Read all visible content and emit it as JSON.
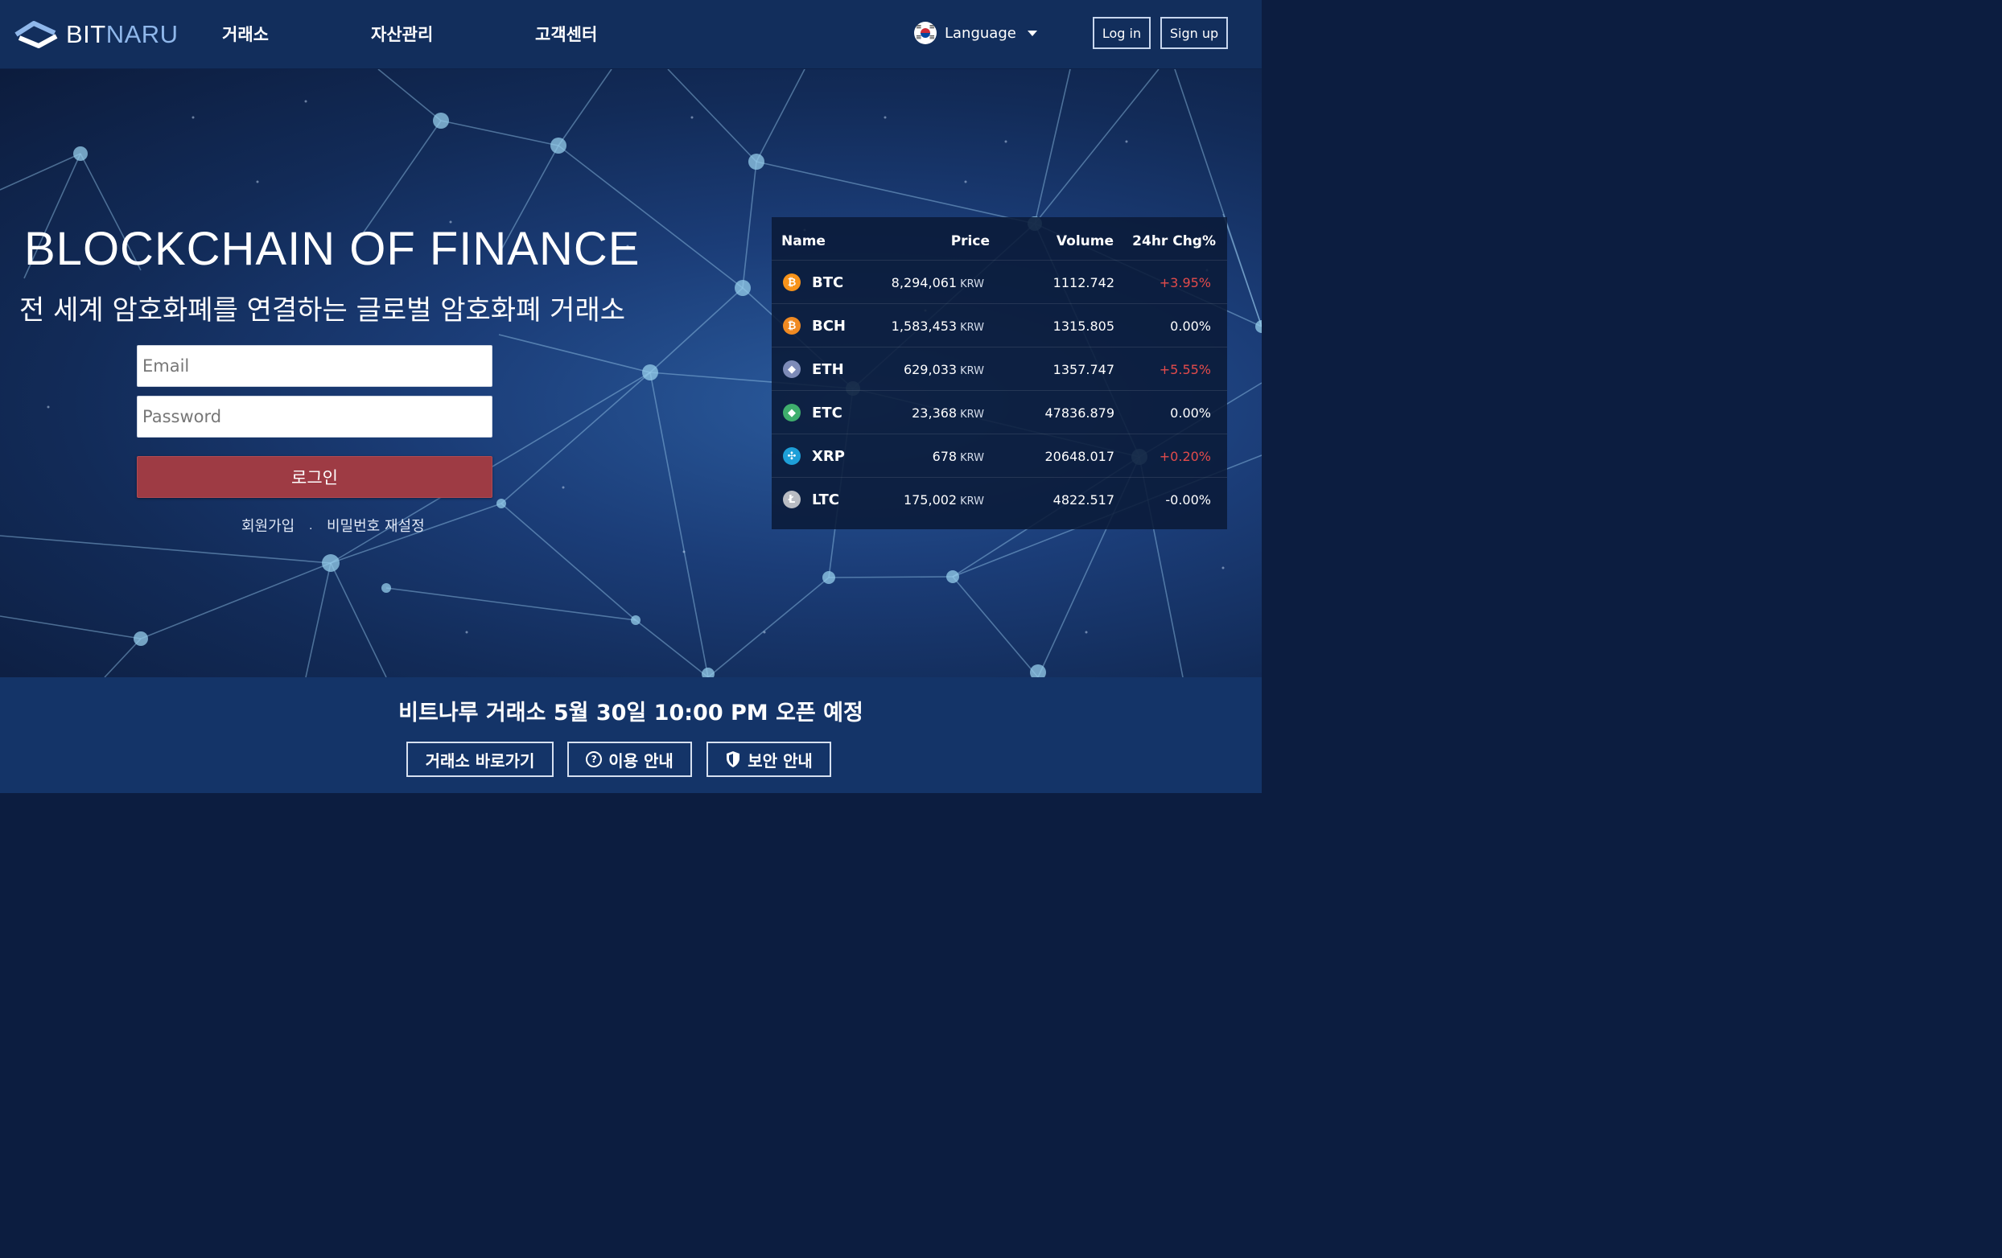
{
  "header": {
    "logo": {
      "part1": "BIT",
      "part2": "NARU"
    },
    "nav": [
      "거래소",
      "자산관리",
      "고객센터"
    ],
    "language_label": "Language",
    "login_label": "Log in",
    "signup_label": "Sign up"
  },
  "hero": {
    "title": "BLOCKCHAIN OF FINANCE",
    "subtitle": "전 세계 암호화폐를 연결하는 글로벌 암호화폐 거래소",
    "email_placeholder": "Email",
    "password_placeholder": "Password",
    "login_button": "로그인",
    "signup_link": "회원가입",
    "separator": ".",
    "reset_link": "비밀번호 재설정"
  },
  "market": {
    "headers": {
      "name": "Name",
      "price": "Price",
      "volume": "Volume",
      "change": "24hr Chg%"
    },
    "unit": "KRW",
    "rows": [
      {
        "symbol": "BTC",
        "price": "8,294,061",
        "volume": "1112.742",
        "change": "+3.95%",
        "icon": "bitcoin-icon",
        "icon_char": "₿",
        "icon_color": "#f7931a",
        "change_color": "#e34b4b"
      },
      {
        "symbol": "BCH",
        "price": "1,583,453",
        "volume": "1315.805",
        "change": "0.00%",
        "icon": "bitcoin-cash-icon",
        "icon_char": "₿",
        "icon_color": "#f08a22",
        "change_color": "#ffffff"
      },
      {
        "symbol": "ETH",
        "price": "629,033",
        "volume": "1357.747",
        "change": "+5.55%",
        "icon": "ethereum-icon",
        "icon_char": "◆",
        "icon_color": "#7d8bb8",
        "change_color": "#e34b4b"
      },
      {
        "symbol": "ETC",
        "price": "23,368",
        "volume": "47836.879",
        "change": "0.00%",
        "icon": "ethereum-classic-icon",
        "icon_char": "◆",
        "icon_color": "#3fae6d",
        "change_color": "#ffffff"
      },
      {
        "symbol": "XRP",
        "price": "678",
        "volume": "20648.017",
        "change": "+0.20%",
        "icon": "ripple-icon",
        "icon_char": "✣",
        "icon_color": "#1e9fd8",
        "change_color": "#e34b4b"
      },
      {
        "symbol": "LTC",
        "price": "175,002",
        "volume": "4822.517",
        "change": "-0.00%",
        "icon": "litecoin-icon",
        "icon_char": "Ł",
        "icon_color": "#b9bcc3",
        "change_color": "#ffffff"
      }
    ]
  },
  "bottom": {
    "notice": "비트나루 거래소 5월 30일 10:00 PM 오픈 예정",
    "buttons": [
      "거래소 바로가기",
      "이용 안내",
      "보안 안내"
    ]
  },
  "colors": {
    "header_bg": "#122e5c",
    "login_button": "#9e3b44",
    "positive_change": "#e34b4b",
    "bottom_bg": "#143468"
  }
}
